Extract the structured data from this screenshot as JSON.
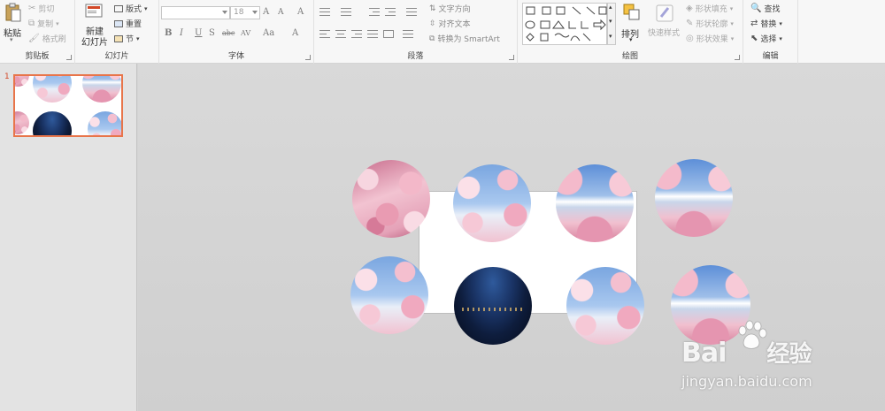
{
  "ribbon": {
    "clipboard": {
      "label": "剪贴板",
      "paste": "粘贴",
      "cut": "剪切",
      "copy": "复制",
      "format_painter": "格式刷"
    },
    "slides": {
      "label": "幻灯片",
      "new_slide_line1": "新建",
      "new_slide_line2": "幻灯片",
      "layout": "版式",
      "reset": "重置",
      "section": "节"
    },
    "font": {
      "label": "字体",
      "font_name": "",
      "font_size": "18",
      "grow": "A",
      "shrink": "A",
      "clear": "A",
      "bold": "B",
      "italic": "I",
      "underline": "U",
      "shadow": "S",
      "strike": "abc",
      "spacing": "AV",
      "case": "Aa",
      "color": "A"
    },
    "paragraph": {
      "label": "段落",
      "text_direction": "文字方向",
      "align_text": "对齐文本",
      "smartart": "转换为 SmartArt"
    },
    "drawing": {
      "label": "绘图",
      "arrange": "排列",
      "quick_styles": "快速样式",
      "shape_fill": "形状填充",
      "shape_outline": "形状轮廓",
      "shape_effects": "形状效果"
    },
    "editing": {
      "label": "编辑",
      "find": "查找",
      "replace": "替换",
      "select": "选择"
    }
  },
  "thumbnails": [
    {
      "number": "1"
    }
  ],
  "watermark": {
    "logo": "Bai",
    "logo_suffix": "经验",
    "url": "jingyan.baidu.com"
  },
  "colors": {
    "accent": "#d24726",
    "thumb_border": "#e8754a"
  }
}
